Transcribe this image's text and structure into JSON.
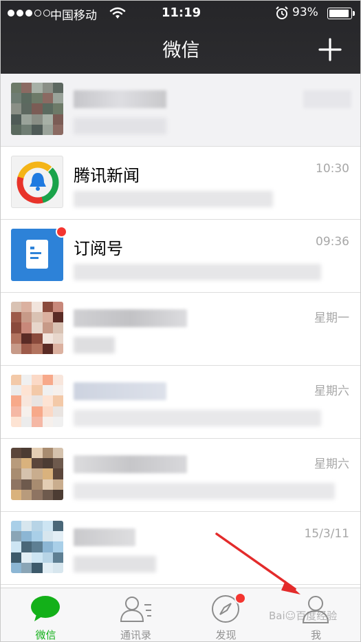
{
  "status_bar": {
    "carrier": "中国移动",
    "time": "11:19",
    "battery_percent": "93%",
    "battery_level": 0.93,
    "signal_bars_filled": 3,
    "signal_bars_total": 5
  },
  "nav": {
    "title": "微信",
    "add_icon": "plus-icon"
  },
  "chats": [
    {
      "name": "",
      "time": "",
      "pinned": true,
      "blurred": true
    },
    {
      "name": "腾讯新闻",
      "time": "10:30",
      "icon": "tencent-news-logo",
      "blurred_preview": true
    },
    {
      "name": "订阅号",
      "time": "09:36",
      "icon": "subscription-icon",
      "unread_dot": true,
      "blurred_preview": true
    },
    {
      "name": "",
      "time": "星期一",
      "blurred": true
    },
    {
      "name": "",
      "time": "星期六",
      "blurred": true
    },
    {
      "name": "",
      "time": "星期六",
      "blurred": true
    },
    {
      "name": "",
      "time": "15/3/11",
      "blurred": true
    }
  ],
  "tabs": [
    {
      "label": "微信",
      "icon": "chat-bubble-icon",
      "active": true
    },
    {
      "label": "通讯录",
      "icon": "contacts-icon",
      "active": false
    },
    {
      "label": "发现",
      "icon": "compass-icon",
      "active": false,
      "badge": true
    },
    {
      "label": "我",
      "icon": "person-icon",
      "active": false
    }
  ],
  "colors": {
    "nav_bg": "#2a2a2d",
    "accent_green": "#13b019",
    "badge_red": "#f43530",
    "tab_inactive": "#929292",
    "time_gray": "#a7a7a7"
  }
}
